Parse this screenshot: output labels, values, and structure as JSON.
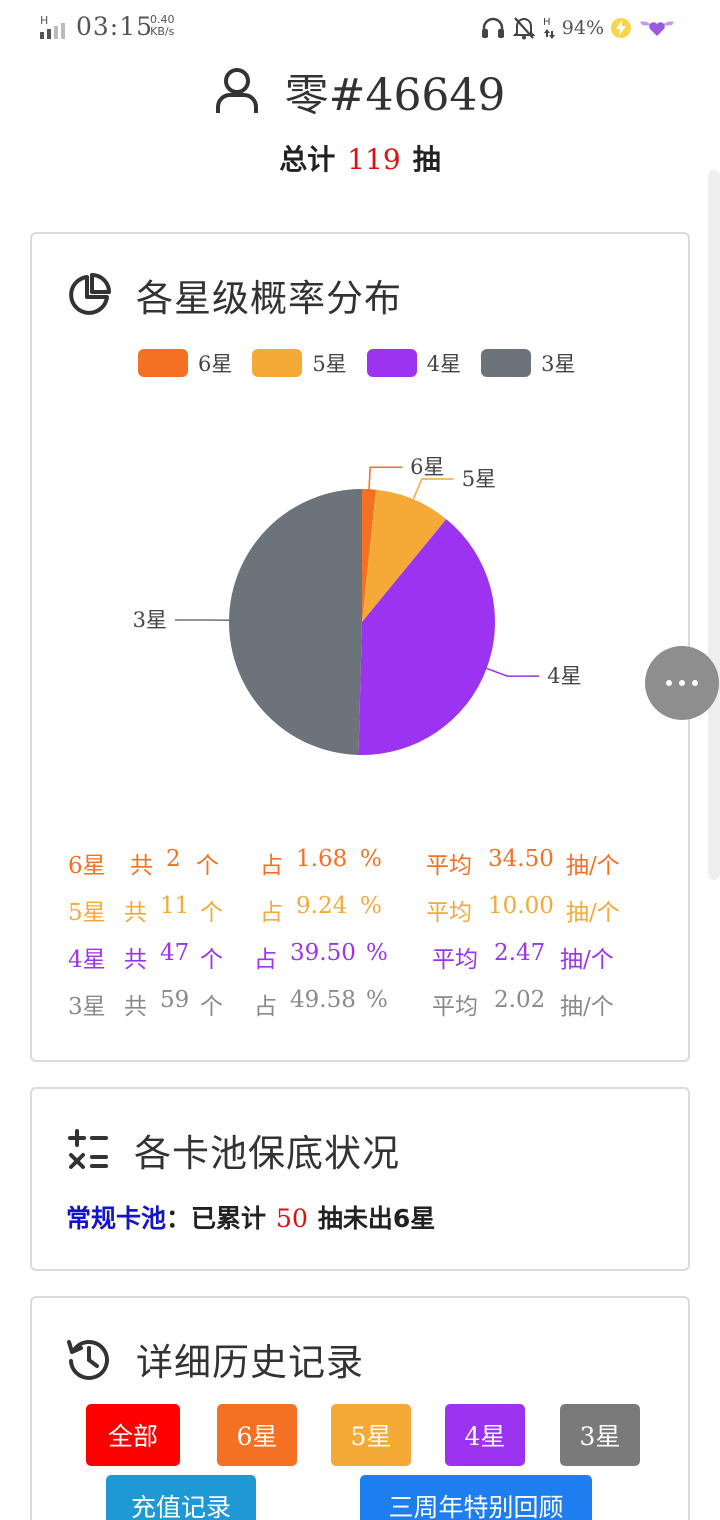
{
  "status_bar": {
    "time": "03:15",
    "net_speed_value": "0.40",
    "net_speed_unit": "KB/s",
    "battery": "94%"
  },
  "header": {
    "username": "零#46649",
    "total_prefix": "总计",
    "total_count": "119",
    "total_suffix": "抽"
  },
  "distribution": {
    "title": "各星级概率分布",
    "legend": [
      "6星",
      "5星",
      "4星",
      "3星"
    ],
    "colors": {
      "6星": "#f47022",
      "5星": "#f5aa38",
      "4星": "#9b33f0",
      "3星": "#6c737a"
    },
    "rows": [
      {
        "star": "6星",
        "count_label": "共",
        "count": "2",
        "unit": "个",
        "pct_label": "占",
        "pct": "1.68",
        "pct_unit": "%",
        "avg_label": "平均",
        "avg": "34.50",
        "avg_unit": "抽/个",
        "color": "#f47022"
      },
      {
        "star": "5星",
        "count_label": "共",
        "count": "11",
        "unit": "个",
        "pct_label": "占",
        "pct": "9.24",
        "pct_unit": "%",
        "avg_label": "平均",
        "avg": "10.00",
        "avg_unit": "抽/个",
        "color": "#f5aa38"
      },
      {
        "star": "4星",
        "count_label": "共",
        "count": "47",
        "unit": "个",
        "pct_label": "占",
        "pct": "39.50",
        "pct_unit": "%",
        "avg_label": "平均",
        "avg": "2.47",
        "avg_unit": "抽/个",
        "color": "#9b33f0"
      },
      {
        "star": "3星",
        "count_label": "共",
        "count": "59",
        "unit": "个",
        "pct_label": "占",
        "pct": "49.58",
        "pct_unit": "%",
        "avg_label": "平均",
        "avg": "2.02",
        "avg_unit": "抽/个",
        "color": "#8a8a8a"
      }
    ]
  },
  "chart_data": {
    "type": "pie",
    "categories": [
      "6星",
      "5星",
      "4星",
      "3星"
    ],
    "values": [
      2,
      11,
      47,
      59
    ],
    "colors": [
      "#f47022",
      "#f5aa38",
      "#9b33f0",
      "#6c737a"
    ],
    "legend_position": "top"
  },
  "pity": {
    "title": "各卡池保底状况",
    "pool_name": "常规卡池",
    "colon": "：",
    "prefix": "已累计",
    "count": "50",
    "suffix": "抽未出6星"
  },
  "history": {
    "title": "详细历史记录",
    "filters": [
      {
        "label": "全部",
        "color": "#ff0000"
      },
      {
        "label": "6星",
        "color": "#f47022"
      },
      {
        "label": "5星",
        "color": "#f5aa38"
      },
      {
        "label": "4星",
        "color": "#9b33f0"
      },
      {
        "label": "3星",
        "color": "#7a7a7a"
      }
    ],
    "extra_buttons": [
      {
        "label": "充值记录",
        "color": "#1f98d6"
      },
      {
        "label": "三周年特别回顾",
        "color": "#1e7ef0"
      }
    ]
  }
}
